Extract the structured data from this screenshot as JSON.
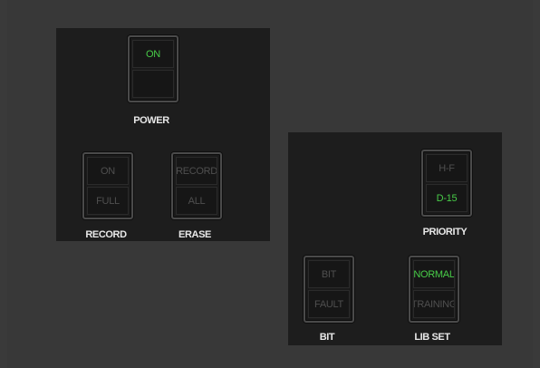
{
  "panels": {
    "left": {
      "power": {
        "upper": "ON",
        "lower": "",
        "label": "POWER"
      },
      "record": {
        "upper": "ON",
        "lower": "FULL",
        "label": "RECORD"
      },
      "erase": {
        "upper": "RECORD",
        "lower": "ALL",
        "label": "ERASE"
      }
    },
    "right": {
      "priority": {
        "upper": "H-F",
        "lower": "D-15",
        "label": "PRIORITY"
      },
      "bit": {
        "upper": "BIT",
        "lower": "FAULT",
        "label": "BIT"
      },
      "lib_set": {
        "upper": "NORMAL",
        "lower": "TRAINING",
        "label": "LIB SET"
      }
    }
  },
  "colors": {
    "background": "#3a3a3a",
    "panel": "#1d1d1d",
    "lit_text": "#48cc48",
    "unlit_text": "#4d4d4d",
    "label_text": "#e8e8e8"
  }
}
